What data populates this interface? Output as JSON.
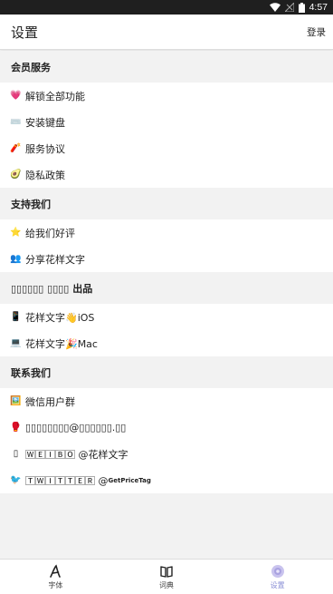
{
  "status": {
    "time": "4:57"
  },
  "header": {
    "title": "设置",
    "login_label": "登录"
  },
  "sections": [
    {
      "title": "会员服务",
      "items": [
        {
          "emoji": "💗",
          "label": "解锁全部功能"
        },
        {
          "emoji": "⌨️",
          "label": "安装键盘"
        },
        {
          "emoji": "🧨",
          "label": "服务协议"
        },
        {
          "emoji": "🥑",
          "label": "隐私政策"
        }
      ]
    },
    {
      "title": "支持我们",
      "items": [
        {
          "emoji": "⭐",
          "label": "给我们好评"
        },
        {
          "emoji": "👥",
          "label": "分享花样文字"
        }
      ]
    },
    {
      "title": "▯▯▯▯▯▯ ▯▯▯▯ 出品",
      "items": [
        {
          "emoji": "📱",
          "label": "花样文字👋iOS"
        },
        {
          "emoji": "💻",
          "label": "花样文字🎉Mac"
        }
      ]
    },
    {
      "title": "联系我们",
      "items": [
        {
          "emoji": "🖼️",
          "label": "微信用户群"
        },
        {
          "emoji": "🥊",
          "label": "▯▯▯▯▯▯▯▯@▯▯▯▯▯▯.▯▯"
        },
        {
          "emoji": "▯",
          "label": "🅆🄴🄸🄱🄾 @花样文字"
        },
        {
          "emoji": "🐦",
          "label": "🅃🅆🄸🅃🅃🄴🅁 @",
          "suffix": "GetPriceTag"
        }
      ]
    }
  ],
  "bottom_nav": [
    {
      "label": "字体",
      "icon": "font-icon"
    },
    {
      "label": "词典",
      "icon": "book-icon"
    },
    {
      "label": "设置",
      "icon": "settings-icon",
      "active": true
    }
  ],
  "colors": {
    "accent": "#8a8fd6",
    "status_bar": "#1f1f1f",
    "background": "#f2f2f2"
  }
}
